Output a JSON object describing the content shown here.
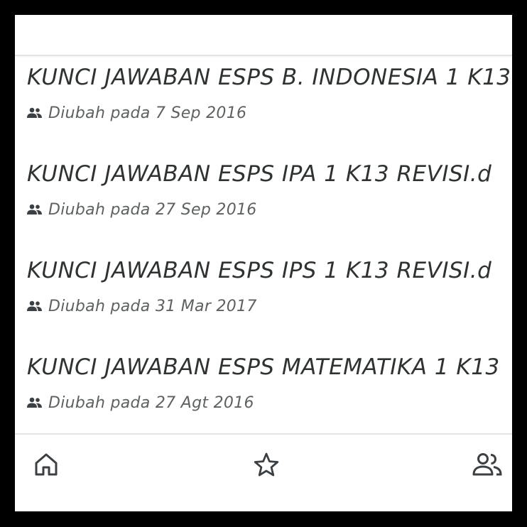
{
  "files": [
    {
      "title": "KUNCI JAWABAN ESPS B. INDONESIA 1 K13",
      "meta": "Diubah pada 7 Sep 2016"
    },
    {
      "title": "KUNCI JAWABAN ESPS IPA 1 K13 REVISI.d",
      "meta": "Diubah pada 27 Sep 2016"
    },
    {
      "title": "KUNCI JAWABAN ESPS IPS 1 K13 REVISI.d",
      "meta": "Diubah pada 31 Mar 2017"
    },
    {
      "title": "KUNCI JAWABAN ESPS MATEMATIKA 1 K13",
      "meta": "Diubah pada 27 Agt 2016"
    }
  ],
  "icons": {
    "meta": "people-icon",
    "nav": [
      "home-icon",
      "star-icon",
      "shared-icon"
    ]
  },
  "colors": {
    "text": "#2f3330",
    "meta_text": "#5d625f",
    "icon": "#3c4043"
  }
}
